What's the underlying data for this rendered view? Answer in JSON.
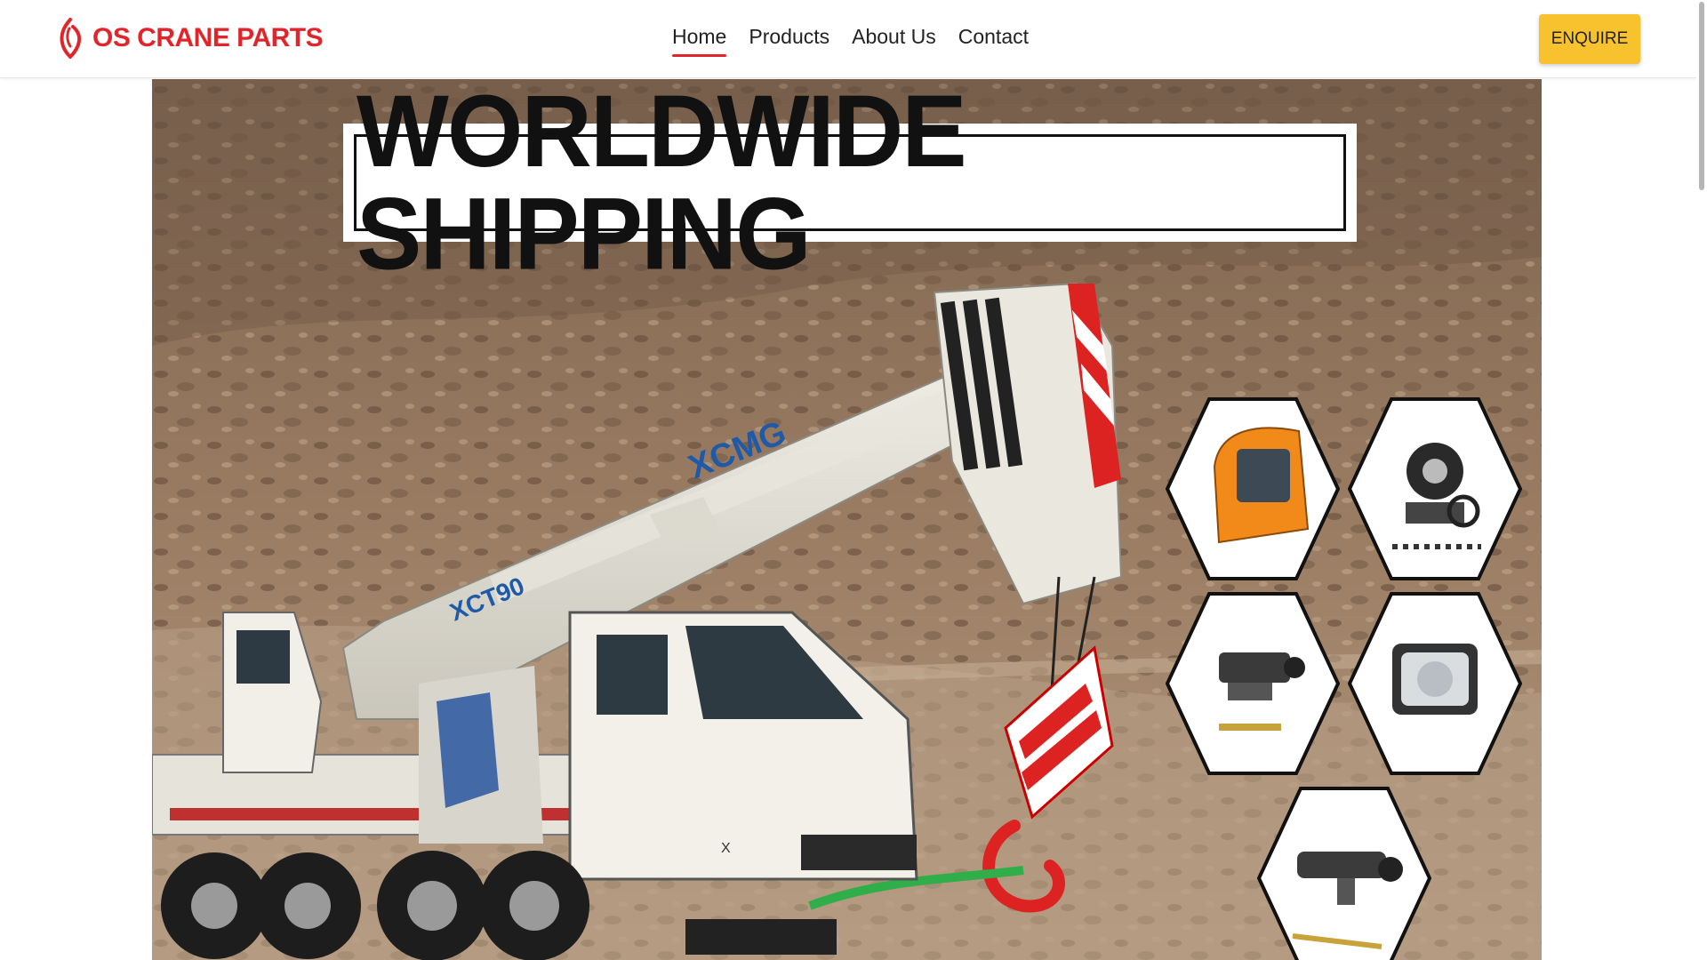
{
  "brand": {
    "name": "OS CRANE PARTS",
    "color": "#e0252b"
  },
  "nav": {
    "items": [
      {
        "label": "Home",
        "active": true
      },
      {
        "label": "Products",
        "active": false
      },
      {
        "label": "About Us",
        "active": false
      },
      {
        "label": "Contact",
        "active": false
      }
    ]
  },
  "enquire": {
    "label": "ENQUIRE",
    "color": "#f8c22f"
  },
  "hero": {
    "banner_text": "WORLDWIDE SHIPPING",
    "crane_brand": "XCMG",
    "crane_model": "XCT90",
    "parts": [
      "cab-part",
      "pump-part",
      "cylinder-part",
      "headlight-part",
      "valve-part"
    ]
  }
}
